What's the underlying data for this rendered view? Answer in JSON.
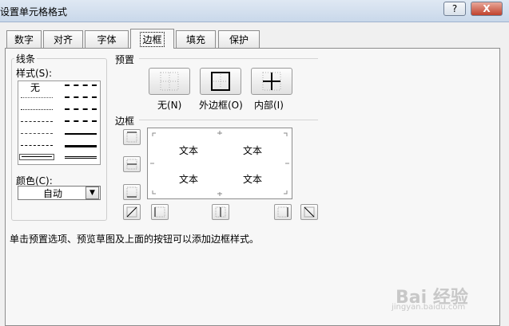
{
  "dialog": {
    "title": "设置单元格格式",
    "help_label": "?",
    "close_label": "X"
  },
  "tabs": [
    {
      "label": "数字"
    },
    {
      "label": "对齐"
    },
    {
      "label": "字体"
    },
    {
      "label": "边框"
    },
    {
      "label": "填充"
    },
    {
      "label": "保护"
    }
  ],
  "line_group": {
    "title": "线条",
    "style_label": "样式(S):",
    "none_label": "无",
    "color_label": "颜色(C):",
    "color_value": "自动"
  },
  "presets": {
    "title": "预置",
    "items": [
      {
        "label": "无(N)"
      },
      {
        "label": "外边框(O)"
      },
      {
        "label": "内部(I)"
      }
    ]
  },
  "border": {
    "title": "边框",
    "preview_text": [
      "文本",
      "文本",
      "文本",
      "文本"
    ]
  },
  "hint": "单击预置选项、预览草图及上面的按钮可以添加边框样式。",
  "watermark": {
    "brand": "Bai 经验",
    "url": "jingyan.baidu.com"
  },
  "colors": {
    "title_bar": "#c9d8ea",
    "close_button": "#c0412c",
    "dialog_bg": "#f7f7f7"
  }
}
